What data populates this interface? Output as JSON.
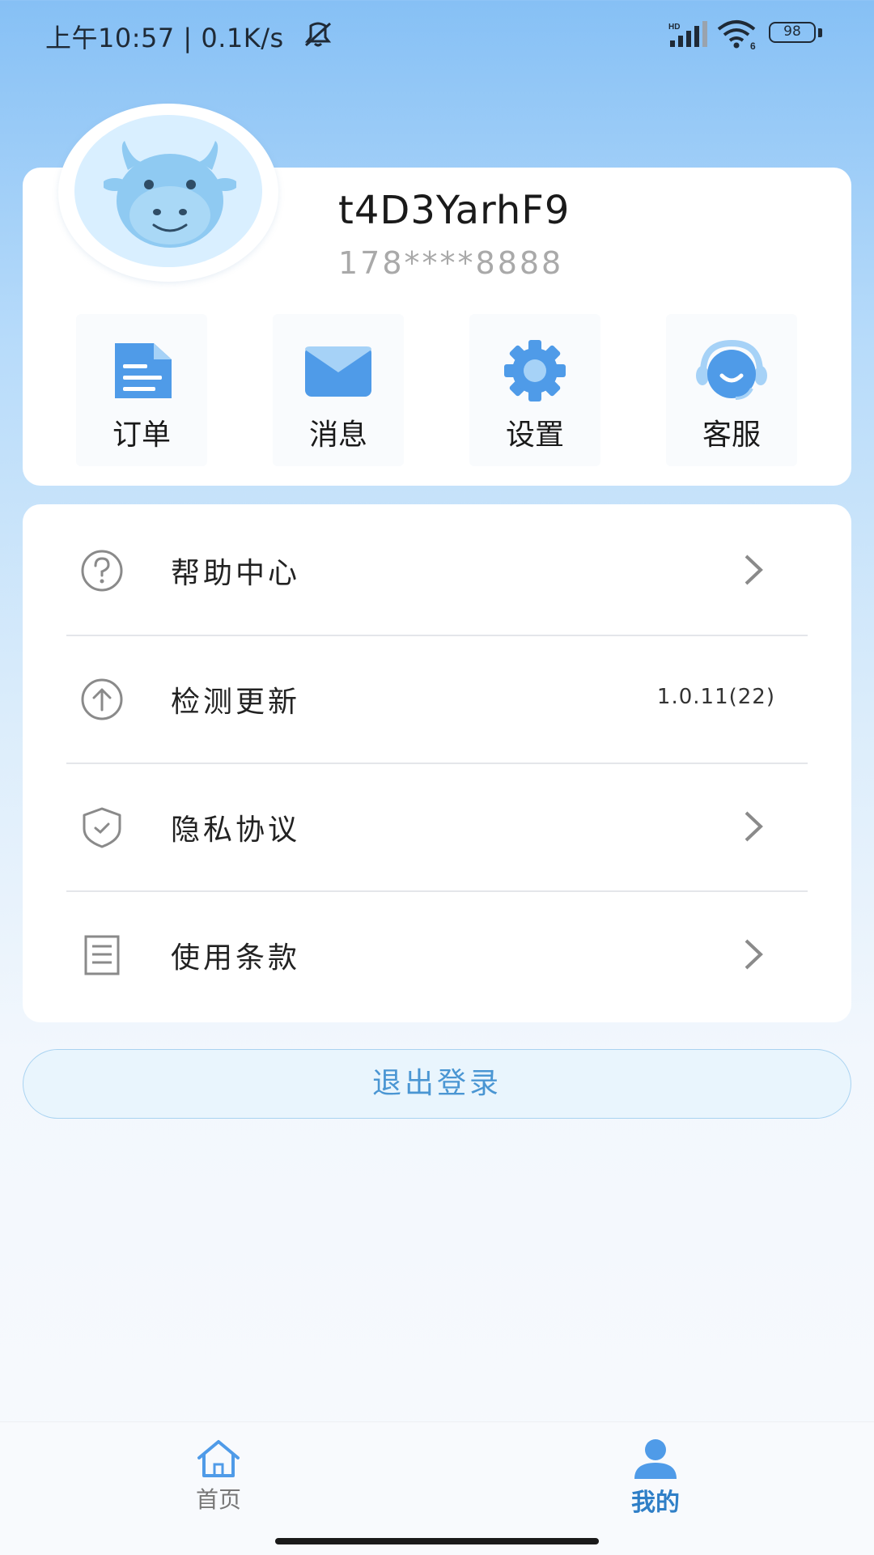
{
  "status_bar": {
    "time": "上午10:57",
    "separator": "|",
    "net_speed": "0.1K/s",
    "battery": "98",
    "network_badge": "HD",
    "wifi_badge": "6"
  },
  "profile": {
    "username": "t4D3YarhF9",
    "phone": "178****8888"
  },
  "quick_actions": [
    {
      "label": "订单",
      "icon": "document-icon"
    },
    {
      "label": "消息",
      "icon": "mail-icon"
    },
    {
      "label": "设置",
      "icon": "gear-icon"
    },
    {
      "label": "客服",
      "icon": "headset-icon"
    }
  ],
  "menu": [
    {
      "label": "帮助中心",
      "icon": "help-icon"
    },
    {
      "label": "检测更新",
      "icon": "upgrade-icon",
      "value": "1.0.11(22)"
    },
    {
      "label": "隐私协议",
      "icon": "shield-icon"
    },
    {
      "label": "使用条款",
      "icon": "terms-icon"
    }
  ],
  "logout_label": "退出登录",
  "tabs": [
    {
      "label": "首页",
      "icon": "home-icon",
      "active": false
    },
    {
      "label": "我的",
      "icon": "user-icon",
      "active": true
    }
  ],
  "colors": {
    "accent": "#4a96d3",
    "icon_blue": "#4f9be8",
    "tab_active": "#2f7fc7"
  }
}
